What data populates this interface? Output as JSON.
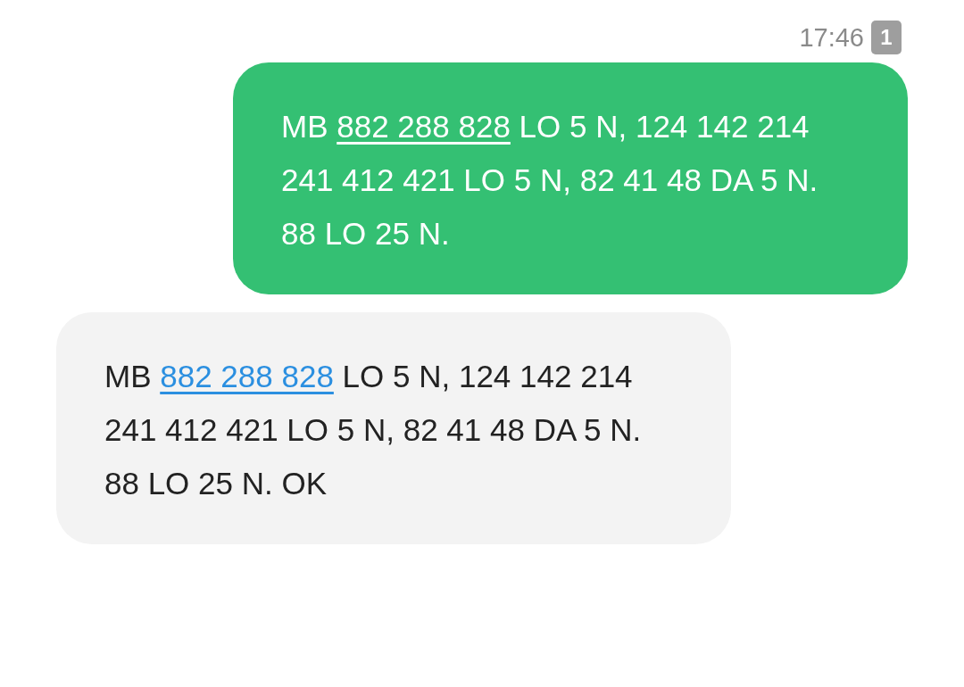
{
  "header": {
    "time": "17:46",
    "badge": "1"
  },
  "messages": [
    {
      "kind": "sent",
      "parts": [
        {
          "kind": "text",
          "text": "MB "
        },
        {
          "kind": "link",
          "text": "882 288 828"
        },
        {
          "kind": "text",
          "text": " LO 5 N, 124 142 214 241 412 421 LO 5 N, 82 41 48 DA 5 N. 88 LO 25 N."
        }
      ]
    },
    {
      "kind": "received",
      "parts": [
        {
          "kind": "text",
          "text": "MB "
        },
        {
          "kind": "link",
          "text": "882 288 828"
        },
        {
          "kind": "text",
          "text": " LO 5 N, 124 142 214 241 412 421 LO 5 N, 82 41 48 DA 5 N. 88 LO 25 N. OK"
        }
      ]
    }
  ]
}
